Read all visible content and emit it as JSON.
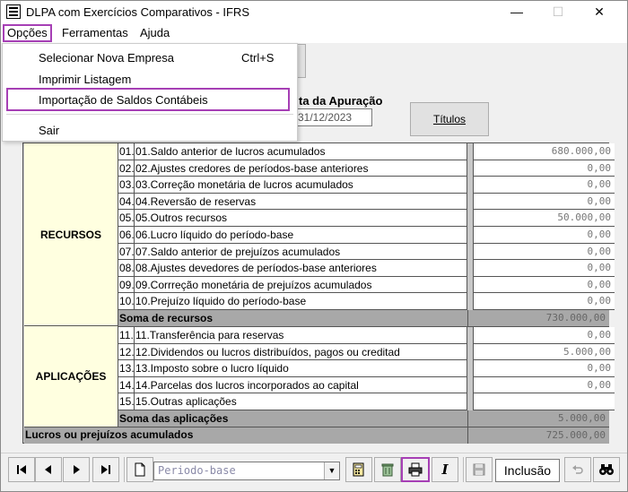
{
  "window": {
    "title": "DLPA com Exercícios Comparativos - IFRS",
    "min_glyph": "—",
    "max_glyph": "☐",
    "close_glyph": "✕"
  },
  "menubar": {
    "items": [
      "Opções",
      "Ferramentas",
      "Ajuda"
    ]
  },
  "dropdown": {
    "items": [
      {
        "label": "Selecionar Nova Empresa",
        "shortcut": "Ctrl+S"
      },
      {
        "label": "Imprimir Listagem"
      },
      {
        "label": "Importação de Saldos Contábeis"
      },
      {
        "label": "Sair"
      }
    ]
  },
  "header": {
    "apuracao_label": "ta da Apuração",
    "date_value": "31/12/2023",
    "titulos_label": "Títulos"
  },
  "table": {
    "recursos_label": "RECURSOS",
    "aplicacoes_label": "APLICAÇÕES",
    "recursos_rows": [
      {
        "num": "01.",
        "desc": "01.Saldo anterior de lucros acumulados",
        "value": "680.000,00"
      },
      {
        "num": "02.",
        "desc": "02.Ajustes credores de períodos-base anteriores",
        "value": "0,00"
      },
      {
        "num": "03.",
        "desc": "03.Correção monetária de lucros acumulados",
        "value": "0,00"
      },
      {
        "num": "04.",
        "desc": "04.Reversão de reservas",
        "value": "0,00"
      },
      {
        "num": "05.",
        "desc": "05.Outros recursos",
        "value": "50.000,00"
      },
      {
        "num": "06.",
        "desc": "06.Lucro líquido do período-base",
        "value": "0,00"
      },
      {
        "num": "07.",
        "desc": "07.Saldo anterior de prejuízos acumulados",
        "value": "0,00"
      },
      {
        "num": "08.",
        "desc": "08.Ajustes devedores de períodos-base anteriores",
        "value": "0,00"
      },
      {
        "num": "09.",
        "desc": "09.Corrreção monetária de prejuízos acumulados",
        "value": "0,00"
      },
      {
        "num": "10.",
        "desc": "10.Prejuízo líquido do período-base",
        "value": "0,00"
      }
    ],
    "soma_recursos": {
      "label": "Soma de recursos",
      "value": "730.000,00"
    },
    "aplicacoes_rows": [
      {
        "num": "11.",
        "desc": "11.Transferência para reservas",
        "value": "0,00"
      },
      {
        "num": "12.",
        "desc": "12.Dividendos ou lucros distribuídos, pagos ou creditad",
        "value": "5.000,00"
      },
      {
        "num": "13.",
        "desc": "13.Imposto sobre o lucro líquido",
        "value": "0,00"
      },
      {
        "num": "14.",
        "desc": "14.Parcelas dos lucros incorporados ao capital",
        "value": "0,00"
      },
      {
        "num": "15.",
        "desc": "15.Outras aplicações",
        "value": ""
      }
    ],
    "soma_aplicacoes": {
      "label": "Soma das aplicações",
      "value": "5.000,00"
    },
    "lucros": {
      "label": "Lucros ou prejuízos acumulados",
      "value": "725.000,00"
    }
  },
  "toolbar": {
    "combo_value": "Periodo-base",
    "mode_value": "Inclusão",
    "italic_glyph": "I"
  }
}
